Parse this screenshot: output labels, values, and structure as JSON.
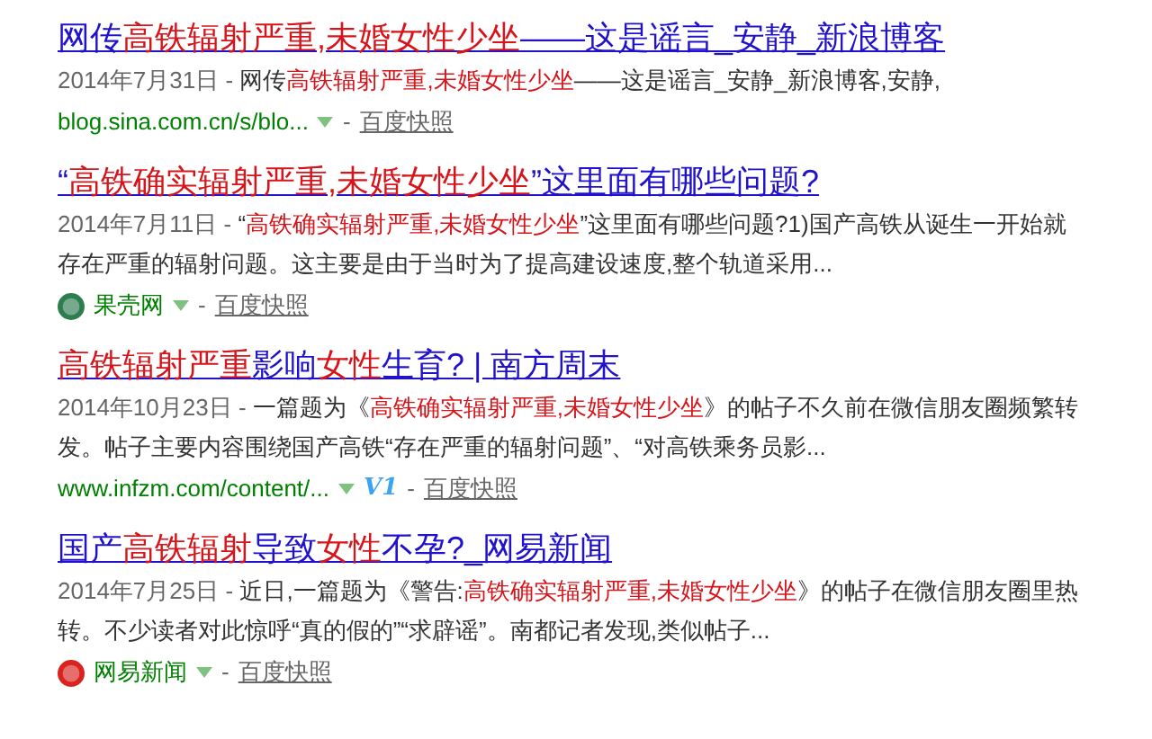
{
  "results": [
    {
      "title": "网传**高铁辐射严重,未婚女性少坐**——这是谣言_安静_新浪博客",
      "date": "2014年7月31日 -",
      "snippet": "网传**高铁辐射严重,未婚女性少坐**——这是谣言_安静_新浪博客,安静,",
      "source": {
        "kind": "url",
        "text": "blog.sina.com.cn/s/blo..."
      },
      "separator": "-",
      "snapshot": "百度快照"
    },
    {
      "title": "“**高铁确实辐射严重,未婚女性少坐**”这里面有哪些问题?",
      "date": "2014年7月11日 -",
      "snippet": "“**高铁确实辐射严重,未婚女性少坐**”这里面有哪些问题?1)国产高铁从诞生一开始就存在严重的辐射问题。这主要是由于当时为了提高建设速度,整个轨道采用...",
      "source": {
        "kind": "site",
        "text": "果壳网",
        "color": "#2e7d4f"
      },
      "separator": "-",
      "snapshot": "百度快照"
    },
    {
      "title": "**高铁辐射严重**影响**女性**生育? | 南方周末",
      "date": "2014年10月23日 -",
      "snippet": "一篇题为《**高铁确实辐射严重,未婚女性少坐**》的帖子不久前在微信朋友圈频繁转发。帖子主要内容围绕国产高铁“存在严重的辐射问题”、“对高铁乘务员影...",
      "source": {
        "kind": "url",
        "text": "www.infzm.com/content/..."
      },
      "badge": "V1",
      "separator": "-",
      "snapshot": "百度快照"
    },
    {
      "title": "国产**高铁辐射**导致**女性**不孕?_网易新闻",
      "date": "2014年7月25日 -",
      "snippet": "近日,一篇题为《警告:**高铁确实辐射严重,未婚女性少坐**》的帖子在微信朋友圈里热转。不少读者对此惊呼“真的假的”“求辟谣”。南都记者发现,类似帖子...",
      "source": {
        "kind": "site",
        "text": "网易新闻",
        "color": "#d9231f"
      },
      "separator": "-",
      "snapshot": "百度快照"
    }
  ]
}
